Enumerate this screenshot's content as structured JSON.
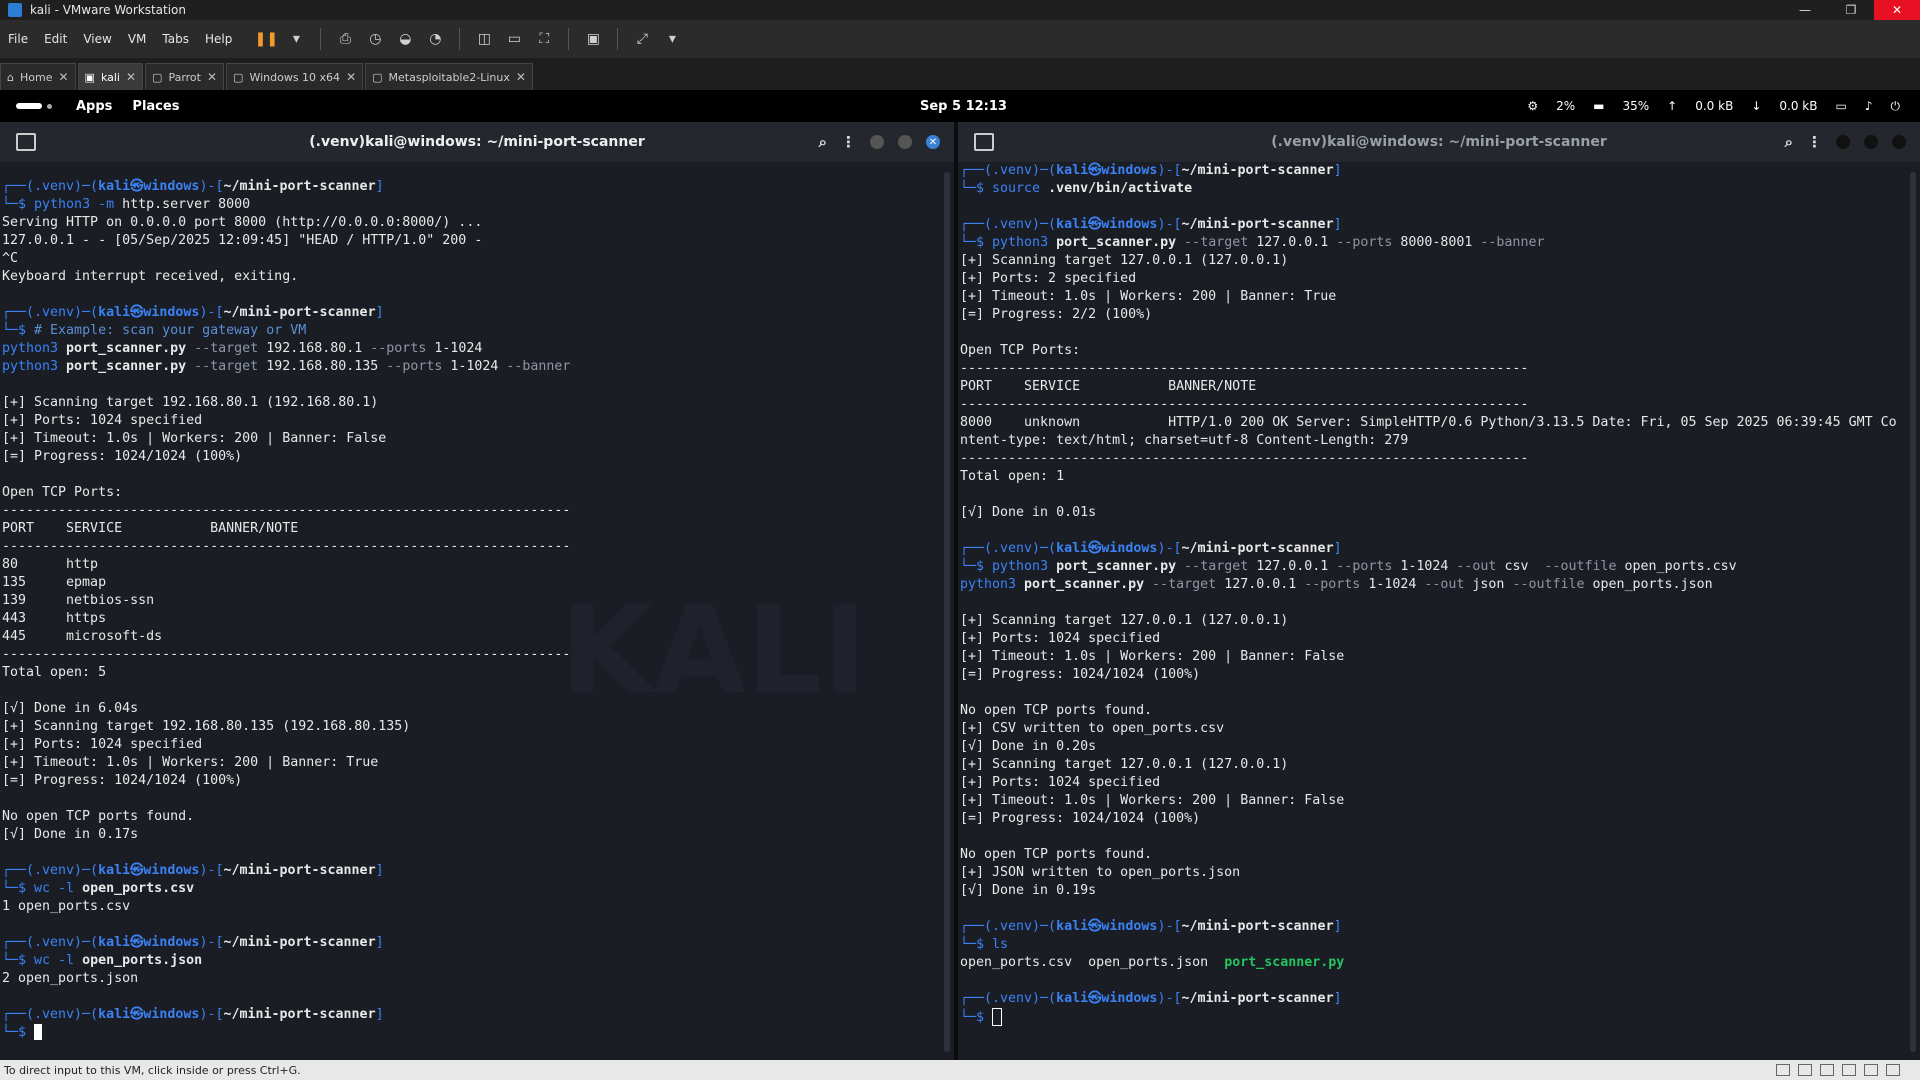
{
  "window": {
    "title": "kali - VMware Workstation",
    "min": "—",
    "max": "❐",
    "close": "✕"
  },
  "menu": [
    "File",
    "Edit",
    "View",
    "VM",
    "Tabs",
    "Help"
  ],
  "tabs": [
    {
      "label": "Home",
      "icon": "⌂"
    },
    {
      "label": "kali",
      "icon": "▣"
    },
    {
      "label": "Parrot",
      "icon": "▢"
    },
    {
      "label": "Windows 10 x64",
      "icon": "▢"
    },
    {
      "label": "Metasploitable2-Linux",
      "icon": "▢"
    }
  ],
  "gnome": {
    "apps": "Apps",
    "places": "Places",
    "clock": "Sep 5  12:13",
    "cpu": "2%",
    "mem": "35%",
    "up": "0.0 kB",
    "down": "0.0 kB"
  },
  "left": {
    "title": "(.venv)kali@windows: ~/mini-port-scanner",
    "prompt_left": "┌──(.venv)─(",
    "user": "kali㉿windows",
    "path_open": ")-[",
    "path": "~/mini-port-scanner",
    "path_close": "]",
    "prompt_line2": "└─$ ",
    "b1_cmd_prefix": "python3 -m",
    "b1_cmd_rest": " http.server 8000",
    "b1_out": "Serving HTTP on 0.0.0.0 port 8000 (http://0.0.0.0:8000/) ...\n127.0.0.1 - - [05/Sep/2025 12:09:45] \"HEAD / HTTP/1.0\" 200 -\n^C\nKeyboard interrupt received, exiting.",
    "b2_comment": "# Example: scan your gateway or VM",
    "b2_l1a": "python3",
    "b2_l1b": " port_scanner.py",
    "b2_l1c": " --target",
    "b2_l1d": " 192.168.80.1",
    "b2_l1e": " --ports",
    "b2_l1f": " 1-1024",
    "b2_l2a": "python3",
    "b2_l2b": " port_scanner.py",
    "b2_l2c": " --target",
    "b2_l2d": " 192.168.80.135",
    "b2_l2e": " --ports",
    "b2_l2f": " 1-1024",
    "b2_l2g": " --banner",
    "b2_out": "\n[+] Scanning target 192.168.80.1 (192.168.80.1)\n[+] Ports: 1024 specified\n[+] Timeout: 1.0s | Workers: 200 | Banner: False\n[=] Progress: 1024/1024 (100%)\n\nOpen TCP Ports:\n-----------------------------------------------------------------------\nPORT    SERVICE           BANNER/NOTE\n-----------------------------------------------------------------------\n80      http\n135     epmap\n139     netbios-ssn\n443     https\n445     microsoft-ds\n-----------------------------------------------------------------------\nTotal open: 5\n\n[√] Done in 6.04s\n[+] Scanning target 192.168.80.135 (192.168.80.135)\n[+] Ports: 1024 specified\n[+] Timeout: 1.0s | Workers: 200 | Banner: True\n[=] Progress: 1024/1024 (100%)\n\nNo open TCP ports found.\n[√] Done in 0.17s",
    "b3_cmd_a": "wc -l",
    "b3_cmd_b": " open_ports.csv",
    "b3_out": "1 open_ports.csv",
    "b4_cmd_a": "wc -l",
    "b4_cmd_b": " open_ports.json",
    "b4_out": "2 open_ports.json"
  },
  "right": {
    "title": "(.venv)kali@windows: ~/mini-port-scanner",
    "r0_cmd_a": "source",
    "r0_cmd_b": " .venv/bin/activate",
    "r1_cmd_a": "python3",
    "r1_cmd_b": " port_scanner.py",
    "r1_cmd_c": " --target",
    "r1_cmd_d": " 127.0.0.1",
    "r1_cmd_e": " --ports",
    "r1_cmd_f": " 8000-8001",
    "r1_cmd_g": " --banner",
    "r1_out": "[+] Scanning target 127.0.0.1 (127.0.0.1)\n[+] Ports: 2 specified\n[+] Timeout: 1.0s | Workers: 200 | Banner: True\n[=] Progress: 2/2 (100%)\n\nOpen TCP Ports:\n-----------------------------------------------------------------------\nPORT    SERVICE           BANNER/NOTE\n-----------------------------------------------------------------------\n8000    unknown           HTTP/1.0 200 OK Server: SimpleHTTP/0.6 Python/3.13.5 Date: Fri, 05 Sep 2025 06:39:45 GMT Co\nntent-type: text/html; charset=utf-8 Content-Length: 279\n-----------------------------------------------------------------------\nTotal open: 1\n\n[√] Done in 0.01s",
    "r2_l1a": "python3",
    "r2_l1b": " port_scanner.py",
    "r2_l1c": " --target",
    "r2_l1d": " 127.0.0.1",
    "r2_l1e": " --ports",
    "r2_l1f": " 1-1024",
    "r2_l1g": " --out",
    "r2_l1h": " csv",
    "r2_l1i": "  --outfile",
    "r2_l1j": " open_ports.csv",
    "r2_l2a": "python3",
    "r2_l2b": " port_scanner.py",
    "r2_l2c": " --target",
    "r2_l2d": " 127.0.0.1",
    "r2_l2e": " --ports",
    "r2_l2f": " 1-1024",
    "r2_l2g": " --out",
    "r2_l2h": " json",
    "r2_l2i": " --outfile",
    "r2_l2j": " open_ports.json",
    "r2_out": "\n[+] Scanning target 127.0.0.1 (127.0.0.1)\n[+] Ports: 1024 specified\n[+] Timeout: 1.0s | Workers: 200 | Banner: False\n[=] Progress: 1024/1024 (100%)\n\nNo open TCP ports found.\n[+] CSV written to open_ports.csv\n[√] Done in 0.20s\n[+] Scanning target 127.0.0.1 (127.0.0.1)\n[+] Ports: 1024 specified\n[+] Timeout: 1.0s | Workers: 200 | Banner: False\n[=] Progress: 1024/1024 (100%)\n\nNo open TCP ports found.\n[+] JSON written to open_ports.json\n[√] Done in 0.19s",
    "r3_cmd": "ls",
    "r3_out_a": "open_ports.csv  open_ports.json  ",
    "r3_out_b": "port_scanner.py"
  },
  "statusbar": {
    "text": "To direct input to this VM, click inside or press Ctrl+G."
  },
  "watermark": "KALI",
  "colors": {
    "prompt": "#3b82f6",
    "exec": "#22c55e",
    "bg": "#1a1d23"
  }
}
